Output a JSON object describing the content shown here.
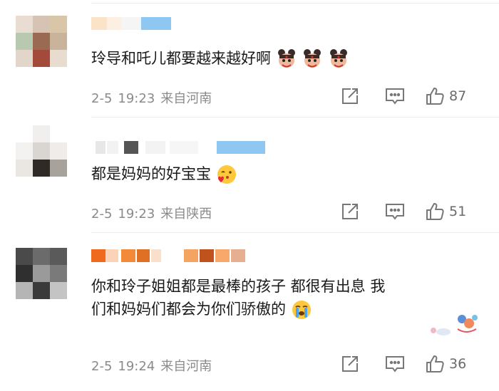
{
  "comments": [
    {
      "text": "玲导和吒儿都要越来越好啊",
      "emojis": [
        "nezha-emoji",
        "nezha-emoji",
        "nezha-emoji"
      ],
      "date": "2-5",
      "time": "19:23",
      "location": "来自河南",
      "likes": "87"
    },
    {
      "text": "都是妈妈的好宝宝",
      "emojis": [
        "heart-kiss-emoji"
      ],
      "date": "2-5",
      "time": "19:23",
      "location": "来自陕西",
      "likes": "51"
    },
    {
      "text_line1": "你和玲子姐姐都是最棒的孩子 都很有出息 我",
      "text_line2": "们和妈妈们都会为你们骄傲的",
      "emojis": [
        "crying-emoji"
      ],
      "date": "2-5",
      "time": "19:24",
      "location": "来自河南",
      "likes": "36"
    }
  ],
  "icons": {
    "share": "share-icon",
    "comment": "comment-icon",
    "like": "thumbs-up-icon"
  },
  "colors": {
    "text": "#1a1a1a",
    "meta": "#8a8a8a",
    "divider": "#ececec"
  }
}
